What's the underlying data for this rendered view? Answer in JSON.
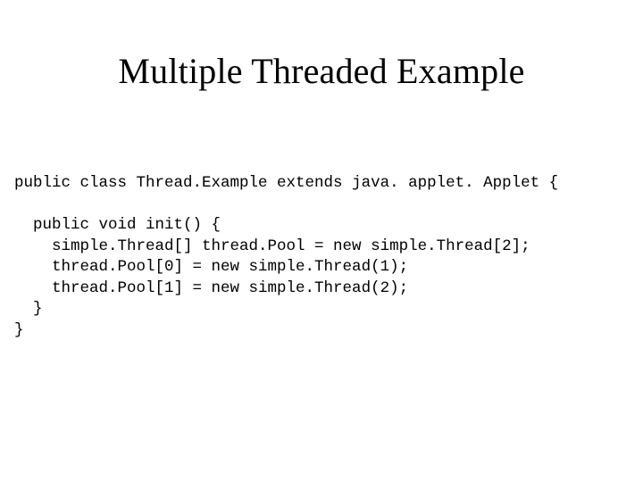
{
  "title": "Multiple Threaded Example",
  "code": {
    "l0": "public class Thread.Example extends java. applet. Applet {",
    "l1": "",
    "l2": "  public void init() {",
    "l3": "    simple.Thread[] thread.Pool = new simple.Thread[2];",
    "l4": "    thread.Pool[0] = new simple.Thread(1);",
    "l5": "    thread.Pool[1] = new simple.Thread(2);",
    "l6": "  }",
    "l7": "}"
  }
}
